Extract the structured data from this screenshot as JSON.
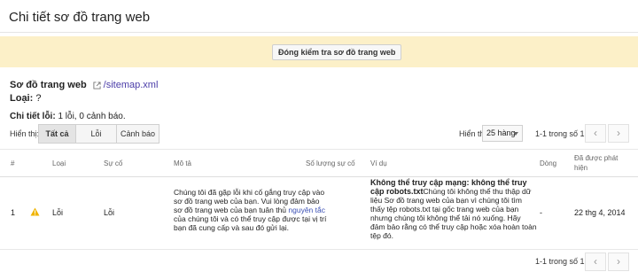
{
  "page": {
    "title": "Chi tiết sơ đồ trang web"
  },
  "banner": {
    "close_button": "Đóng kiểm tra sơ đồ trang web"
  },
  "sitemap": {
    "label": "Sơ đồ trang web",
    "link_text": "/sitemap.xml",
    "link_icon": "external-link-icon"
  },
  "type": {
    "label": "Loại:",
    "value": " ?"
  },
  "details": {
    "label": "Chi tiết lỗi:",
    "value": " 1 lỗi, 0 cảnh báo."
  },
  "filter": {
    "show_label": "Hiển thị:",
    "options": [
      "Tất cả",
      "Lỗi",
      "Cảnh báo"
    ],
    "selected": "Tất cả"
  },
  "pagination": {
    "show_label": "Hiển thị:",
    "rows_per_page": "25 hàng",
    "range": "1-1 trong số 1"
  },
  "table": {
    "headers": {
      "num": "#",
      "type": "Loại",
      "issue": "Sự cố",
      "description": "Mô tả",
      "issue_count": "Số lượng sự cố",
      "example": "Ví dụ",
      "line": "Dòng",
      "detected": "Đã được phát hiện"
    },
    "rows": [
      {
        "num": "1",
        "type_icon": "warning-icon",
        "type": "Lỗi",
        "issue": "Lỗi",
        "description_1": "Chúng tôi đã gặp lỗi khi cố gắng truy cập vào sơ đồ trang web của bạn. Vui lòng đảm bảo sơ đồ trang web của bạn tuân thủ ",
        "description_link": "nguyên tắc",
        "description_2": " của chúng tôi và có thể truy cập được tại vị trí bạn đã cung cấp và sau đó gửi lại.",
        "example_title": "Không thể truy cập mạng: không thể truy cập robots.txt",
        "example_text": "Chúng tôi không thể thu thập dữ liệu Sơ đồ trang web của bạn vì chúng tôi tìm thấy tệp robots.txt tại gốc trang web của bạn nhưng chúng tôi không thể tải nó xuống. Hãy đảm bảo rằng có thể truy cập hoặc xóa hoàn toàn tệp đó.",
        "line": "-",
        "detected": "22 thg 4, 2014"
      }
    ]
  },
  "colors": {
    "banner_bg": "#fcf0c8",
    "link": "#4a3ca8",
    "warning": "#f0b400"
  }
}
